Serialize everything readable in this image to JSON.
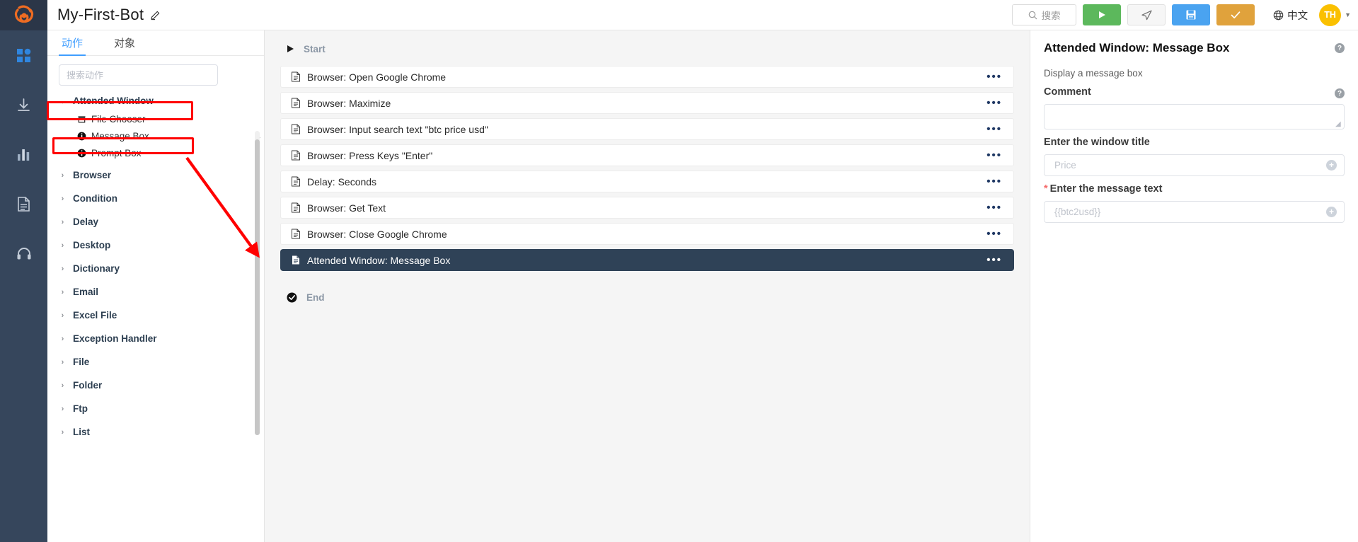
{
  "app": {
    "logo_icon": "app-logo-icon",
    "bot_title": "My-First-Bot",
    "edit_icon": "pencil-edit-icon"
  },
  "rail": {
    "items": [
      {
        "icon": "dashboard-grid-icon",
        "name": "sidebar-rail-dashboard"
      },
      {
        "icon": "download-icon",
        "name": "sidebar-rail-download"
      },
      {
        "icon": "bar-chart-icon",
        "name": "sidebar-rail-reports"
      },
      {
        "icon": "document-icon",
        "name": "sidebar-rail-documents"
      },
      {
        "icon": "headset-icon",
        "name": "sidebar-rail-support"
      }
    ]
  },
  "toolbar": {
    "search_label": "搜索",
    "search_icon": "search-icon",
    "run_icon": "play-triangle-icon",
    "step_icon": "paper-plane-icon",
    "save_icon": "floppy-disk-icon",
    "check_icon": "checkmark-icon",
    "globe_icon": "globe-icon",
    "language_label": "中文",
    "avatar_initials": "TH",
    "avatar_caret_icon": "caret-down-icon",
    "colors": {
      "run": "#5cb85c",
      "save": "#4aa3f0",
      "check": "#e0a23c",
      "avatar": "#fac000"
    }
  },
  "actions_panel": {
    "tabs": [
      {
        "label": "动作",
        "active": true
      },
      {
        "label": "对象",
        "active": false
      }
    ],
    "search_placeholder": "搜索动作",
    "search_value": "",
    "expanded_group": {
      "label": "Attended Window",
      "chevron_icon": "chevron-down-icon",
      "children": [
        {
          "label": "File Chooser",
          "icon": "file-chooser-icon"
        },
        {
          "label": "Message Box",
          "icon": "info-circle-icon",
          "highlighted": true
        },
        {
          "label": "Prompt Box",
          "icon": "info-circle-icon"
        }
      ]
    },
    "groups": [
      {
        "label": "Browser",
        "chevron_icon": "chevron-right-icon"
      },
      {
        "label": "Condition",
        "chevron_icon": "chevron-right-icon"
      },
      {
        "label": "Delay",
        "chevron_icon": "chevron-right-icon"
      },
      {
        "label": "Desktop",
        "chevron_icon": "chevron-right-icon"
      },
      {
        "label": "Dictionary",
        "chevron_icon": "chevron-right-icon"
      },
      {
        "label": "Email",
        "chevron_icon": "chevron-right-icon"
      },
      {
        "label": "Excel File",
        "chevron_icon": "chevron-right-icon"
      },
      {
        "label": "Exception Handler",
        "chevron_icon": "chevron-right-icon"
      },
      {
        "label": "File",
        "chevron_icon": "chevron-right-icon"
      },
      {
        "label": "Folder",
        "chevron_icon": "chevron-right-icon"
      },
      {
        "label": "Ftp",
        "chevron_icon": "chevron-right-icon"
      },
      {
        "label": "List",
        "chevron_icon": "chevron-right-icon"
      }
    ]
  },
  "flow": {
    "start_label": "Start",
    "start_icon": "play-triangle-icon",
    "end_label": "End",
    "end_icon": "check-circle-icon",
    "menu_dots": "•••",
    "steps": [
      {
        "label": "Browser: Open Google Chrome",
        "icon": "step-document-icon",
        "selected": false
      },
      {
        "label": "Browser: Maximize",
        "icon": "step-document-icon",
        "selected": false
      },
      {
        "label": "Browser: Input search text \"btc price usd\"",
        "icon": "step-document-icon",
        "selected": false
      },
      {
        "label": "Browser: Press Keys \"Enter\"",
        "icon": "step-document-icon",
        "selected": false
      },
      {
        "label": "Delay: Seconds",
        "icon": "step-document-icon",
        "selected": false
      },
      {
        "label": "Browser: Get Text",
        "icon": "step-document-icon",
        "selected": false
      },
      {
        "label": "Browser: Close Google Chrome",
        "icon": "step-document-icon",
        "selected": false
      },
      {
        "label": "Attended Window: Message Box",
        "icon": "step-document-icon",
        "selected": true
      }
    ]
  },
  "properties": {
    "title": "Attended Window: Message Box",
    "help_icon": "question-mark-icon",
    "description": "Display a message box",
    "comment_label": "Comment",
    "comment_value": "",
    "window_title_label": "Enter the window title",
    "window_title_value": "Price",
    "window_title_placeholder": "Price",
    "message_text_label": "Enter the message text",
    "message_text_required": "*",
    "message_text_value": "{{btc2usd}}",
    "message_text_placeholder": "{{btc2usd}}",
    "add_icon": "plus-circle-icon"
  },
  "annotations": {
    "highlight_color": "#ff0000",
    "boxes": [
      {
        "name": "highlight-attended-window-group"
      },
      {
        "name": "highlight-message-box-item"
      }
    ],
    "arrow": {
      "name": "annotation-arrow-to-selected-step"
    }
  }
}
